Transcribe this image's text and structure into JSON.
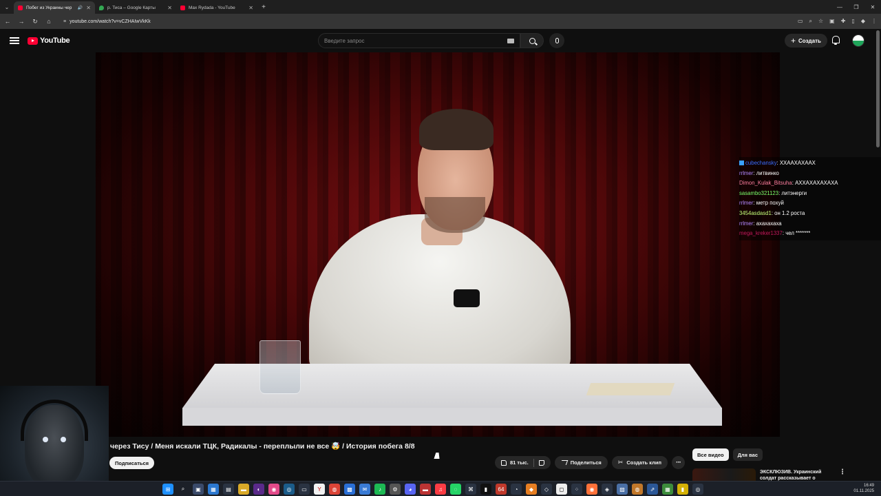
{
  "browser": {
    "tabs": [
      {
        "label": "Побег из Украины чер",
        "favicon": "youtube",
        "active": true,
        "audio": true
      },
      {
        "label": "р. Тиса – Google Карты",
        "favicon": "maps",
        "active": false
      },
      {
        "label": "Max Rydada - YouTube",
        "favicon": "youtube",
        "active": false
      }
    ],
    "url": "youtube.com/watch?v=vCZHAIwVkKk"
  },
  "youtube": {
    "logo_text": "YouTube",
    "search_placeholder": "Введите запрос",
    "create_label": "Создать"
  },
  "video": {
    "title": "через Тису / Меня искали ТЦК, Радикалы - переплыли не все 🤯 / История побега 8/8",
    "subscribe_label": "Подписаться",
    "likes": "81 тыс.",
    "share_label": "Поделиться",
    "clip_label": "Создать клип"
  },
  "chat": [
    {
      "nick": "cubechansky",
      "color": "#3b6cff",
      "text": "ХХААХАХААХ",
      "badge": true
    },
    {
      "nick": "rrlmer",
      "color": "#b388ff",
      "text": "литвинко"
    },
    {
      "nick": "Dimon_Kulak_Bitsuha",
      "color": "#ff7fa0",
      "text": "АХХАХАХАХАХА"
    },
    {
      "nick": "sasambo321123",
      "color": "#7cff6b",
      "text": "литэнерги"
    },
    {
      "nick": "rrlmer",
      "color": "#b388ff",
      "text": "метр похуй"
    },
    {
      "nick": "3454asdasd1",
      "color": "#c6ff7a",
      "text": "он 1.2 роста"
    },
    {
      "nick": "rrlmer",
      "color": "#b388ff",
      "text": "ахахахаха"
    },
    {
      "nick": "mega_kreker1337",
      "color": "#c2185b",
      "text": "чел *******"
    }
  ],
  "sidebar": {
    "chips": [
      "Все видео",
      "Для вас"
    ],
    "recommendation_title": "ЭКСКЛЮЗИВ. Украинский солдат рассказывает о"
  },
  "taskbar": {
    "time": "16:49",
    "date": "01.11.2025",
    "badge_64": "64"
  }
}
